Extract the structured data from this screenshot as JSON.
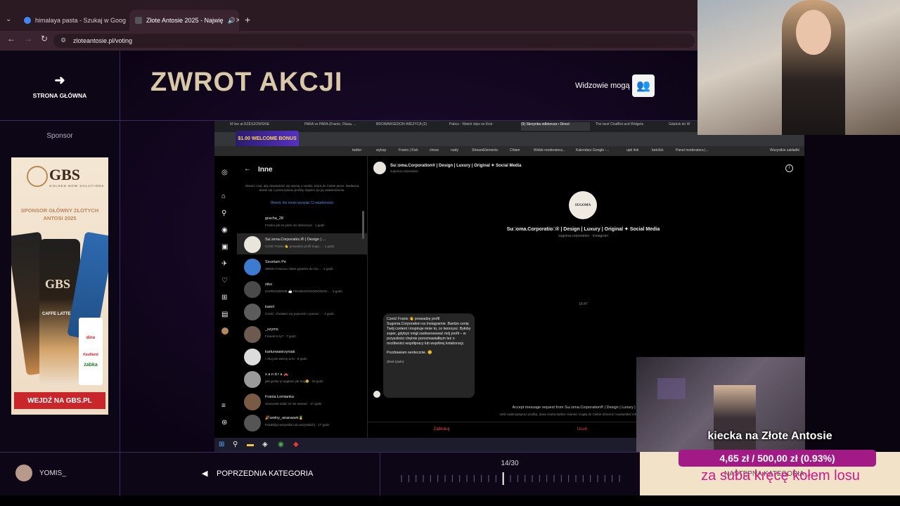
{
  "browser": {
    "tabs": [
      {
        "title": "himalaya pasta - Szukaj w Goog",
        "fav_color": "#4285f4",
        "active": false
      },
      {
        "title": "Złote Antosie 2025 - Najwię",
        "fav_color": "#2b2b2b",
        "active": true
      }
    ],
    "new_tab": "+",
    "url": "zloteantosie.pl/voting"
  },
  "page": {
    "home_label": "STRONA GŁÓWNA",
    "category_title": "ZWROT AKCJI",
    "viewers_label": "Widzowie mogą",
    "sponsor_label": "Sponsor",
    "sponsor_ad": {
      "brand": "GBS",
      "brand_sub": "GOLDEN BOW SOLUTIONS",
      "headline": "SPONSOR GŁÓWNY ZŁOTYCH ANTOSI 2025",
      "can_text": "CAFFE LATTE",
      "cta": "WEJDŹ NA GBS.PL",
      "badges": [
        "dino",
        "Kaufland",
        "żabka"
      ]
    },
    "footer": {
      "username": "YOMIS_",
      "prev_category": "POPRZEDNIA KATEGORIA",
      "next_category": "NASTĘPNA KATEGORIA",
      "progress_label": "14/30",
      "progress_current": 14,
      "progress_total": 30
    }
  },
  "inner_screen": {
    "tabs": [
      "M live at RZESZOWSKIE",
      "PARA vs PARA (Franio, Olusa, ...",
      "BROWARGEDON WIEŻYCA (2)",
      "Patico - Watch clips on Kick",
      "(9) Skrzynka odbiorcza • Direct",
      "The best ChatBot and Widgets",
      "Gdańsk do W"
    ],
    "promo": "$1.00 WELCOME BONUS",
    "bookmarks": [
      "twitter",
      "wykop",
      "Franio | Kick",
      "chess",
      "nudy",
      "StreamElements",
      "Chłam",
      "Widok moderatora...",
      "Kalendarz Google -...",
      "upb link",
      "betclick",
      "Panel moderatora |...",
      "Wszystkie zakładki"
    ],
    "instagram": {
      "section_title": "Inne",
      "intro": "Otwórz czat, aby dowiedzieć się więcej o osobie, która do Ciebie pisze. Nadawca dowie się o przeczytaniu prośby dopiero po jej zatwierdzeniu.",
      "intro_link": "Określ, kto może wysyłać Ci wiadomości",
      "messages": [
        {
          "name": "gracha_28",
          "preview": "Franko jak se pisze do dziewczyn · 1 godz."
        },
        {
          "name": "Su□oma.Corporatio□® | Design | ...",
          "preview": "Cześć Franio 👋 prowadzę profil Sugo... · 1 godz."
        },
        {
          "name": "Szuetam Pe",
          "preview": "SIEMA Franooo. Mam pytanko do Cie... · 2 godz."
        },
        {
          "name": "niko",
          "preview": "ZAPROSZENIE 📩 FRANIOOOOOOOOOO... · 3 godz."
        },
        {
          "name": "kamil",
          "preview": "Cześć, chciałem cię poprosić o pomoc... · 4 godz."
        },
        {
          "name": "_szyms",
          "preview": "Franek to ty? · 7 godz."
        },
        {
          "name": "karturwawrzyniak",
          "preview": "I chuj nie wierzę w to · 9 godz."
        },
        {
          "name": "s a n d r a 🚗",
          "preview": "jaki gruby ty wyglasz jak bog😂 · 16 godz."
        },
        {
          "name": "Frania Łomianka",
          "preview": "Szacunek wdać ze sie starasz · 17 godz."
        },
        {
          "name": "🎉wolny_ananasek🍍",
          "preview": "Polubił(a) wszystkim do wszystkich) · 17 godz."
        }
      ],
      "chat_header": "Su□oma.Corporation® | Design | Luxury | Original ✦ Social Media",
      "chat_header_sub": "sugoma.corporation",
      "profile_name": "Su□oma.Corporatio□® | Design | Luxury | Original ✦ Social Media",
      "profile_sub": "sugoma.corporation · Instagram",
      "logo_text": "SUGOMA",
      "time": "16:47",
      "message": "Cześć Franio 👋 prowadzę profil Sugoma.Corporation na Instagramie. Bardzo cenię Twój content i inspiruje mnie to, co tworzysz. Byłoby super, gdybyś mógł zaobserwować mój profil – w przyszłości chętnie porozmawiałbym też o możliwości współpracy lub wspólnej kolaboracji.",
      "message_sign": "Pozdrawiam serdecznie. 😊",
      "message_caption": "(Brak tytułu)",
      "accept_text": "Accept message request from Su□oma.Corporation® | Design | Luxury | Original ✦ So",
      "accept_sub": "Jeśli zaakceptujesz prośbę, dana osoba będzie również mogła do Ciebie dzwonić i wyświetlać informacje takie jak Twój stat",
      "block": "Zablokuj",
      "delete": "Usuń"
    }
  },
  "overlay": {
    "goal_title": "kiecka na Złote Antosie",
    "goal_amount": "4,65 zł / 500,00 zł (0.93%)",
    "goal_current": 4.65,
    "goal_target": 500.0,
    "goal_subtitle": "za suba kręcę kołem losu"
  },
  "colors": {
    "accent": "#a11a86",
    "title_gold": "#d9c8a8",
    "goal_pink": "#d2188f"
  }
}
